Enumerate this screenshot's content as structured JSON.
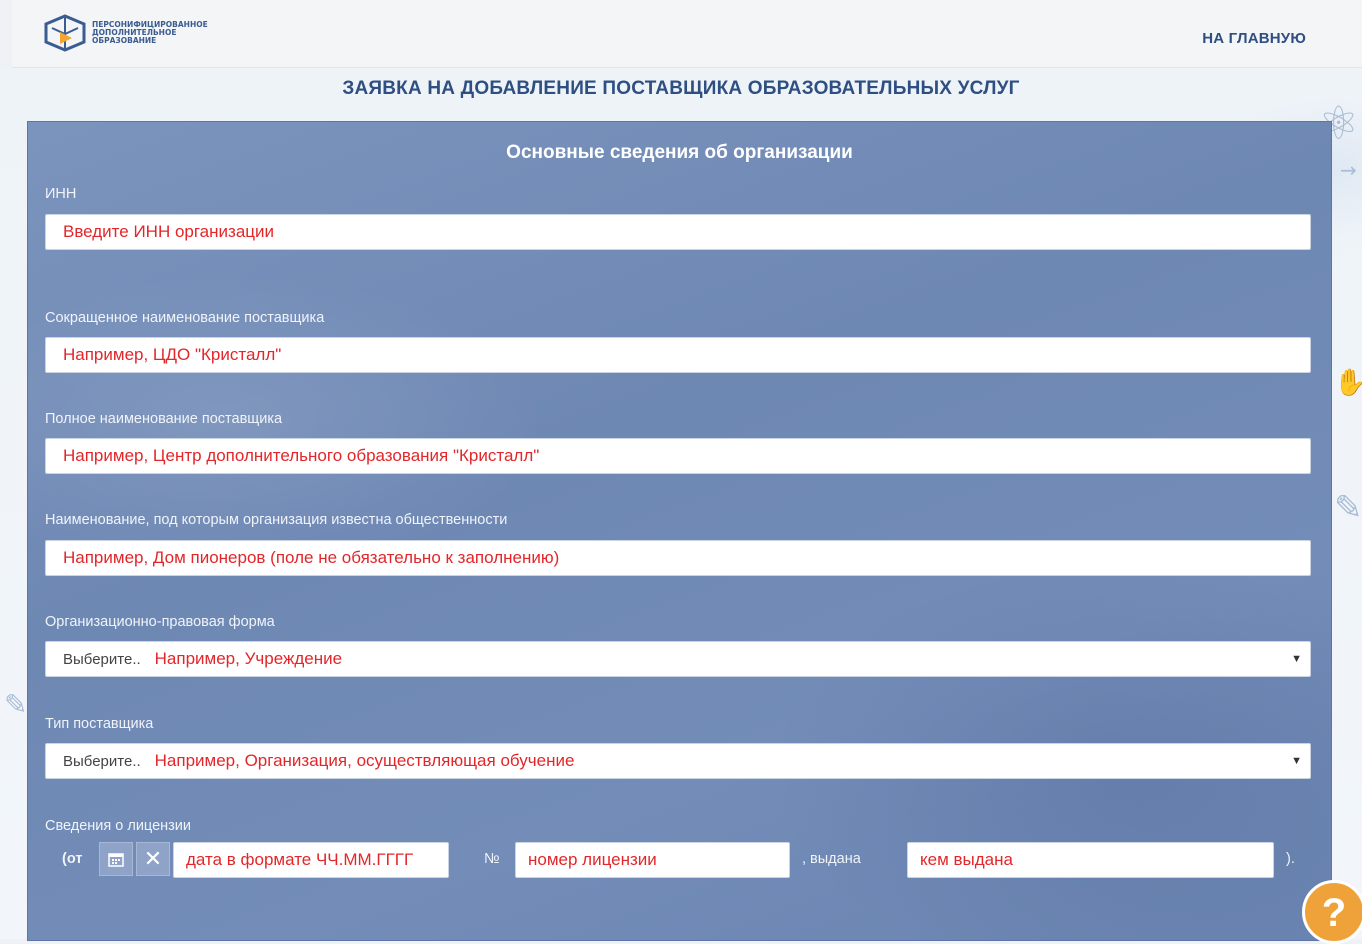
{
  "header": {
    "logo_lines": [
      "ПЕРСОНИФИЦИРОВАННОЕ",
      "ДОПОЛНИТЕЛЬНОЕ",
      "ОБРАЗОВАНИЕ"
    ],
    "home_link": "НА ГЛАВНУЮ"
  },
  "page_title": "ЗАЯВКА НА ДОБАВЛЕНИЕ ПОСТАВЩИКА ОБРАЗОВАТЕЛЬНЫХ УСЛУГ",
  "panel": {
    "title": "Основные сведения об организации",
    "fields": {
      "inn": {
        "label": "ИНН",
        "value": "Введите ИНН организации"
      },
      "short_name": {
        "label": "Сокращенное наименование поставщика",
        "value": "Например, ЦДО \"Кристалл\""
      },
      "full_name": {
        "label": "Полное наименование поставщика",
        "value": "Например, Центр дополнительного образования \"Кристалл\""
      },
      "public_name": {
        "label": "Наименование, под которым организация известна общественности",
        "value": "Например, Дом пионеров (поле не обязательно к заполнению)"
      },
      "legal_form": {
        "label": "Организационно-правовая форма",
        "prefix": "Выберите..",
        "value": "Например, Учреждение"
      },
      "provider_type": {
        "label": "Тип поставщика",
        "prefix": "Выберите..",
        "value": "Например, Организация, осуществляющая обучение"
      }
    },
    "license": {
      "label": "Сведения о лицензии",
      "from_text": "(от",
      "date_value": "дата в формате ЧЧ.ММ.ГГГГ",
      "number_sign": "№",
      "number_value": "номер лицензии",
      "issued_text": ", выдана",
      "issuer_value": "кем выдана",
      "close_text": ")."
    }
  },
  "help_button": "?",
  "colors": {
    "accent": "#2f4f82",
    "panel": "#7089b5",
    "value_text": "#e3262a",
    "help": "#f0a23a"
  },
  "icons": [
    "logo-icon",
    "calendar-icon",
    "clear-icon",
    "chevron-down-icon",
    "help-icon"
  ]
}
